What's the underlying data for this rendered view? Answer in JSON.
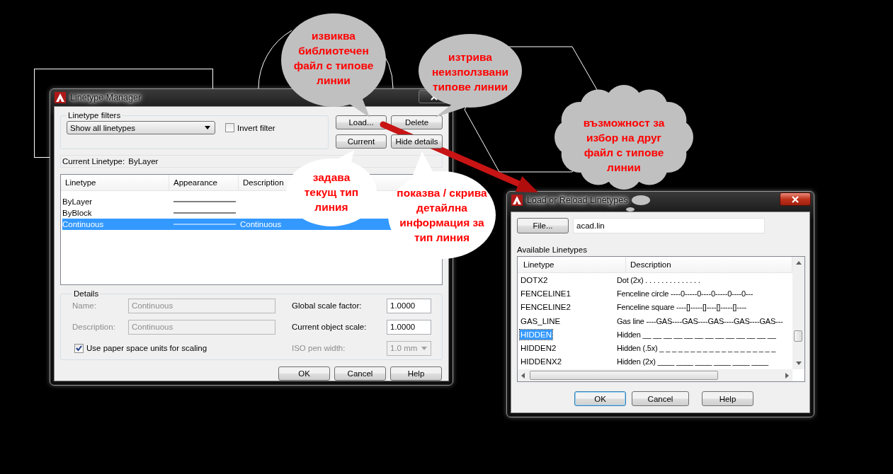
{
  "linetype_manager": {
    "title": "Linetype Manager",
    "filters": {
      "legend": "Linetype filters",
      "dropdown": "Show all linetypes",
      "invert_filter": {
        "label": "Invert filter",
        "checked": false
      }
    },
    "actions": [
      {
        "label": "Load..."
      },
      {
        "label": "Delete"
      },
      {
        "label": "Current"
      },
      {
        "label": "Hide details"
      }
    ],
    "current_linetype": {
      "label": "Current Linetype:",
      "value": "ByLayer"
    },
    "list": {
      "columns": [
        "Linetype",
        "Appearance",
        "Description"
      ],
      "rows": [
        {
          "linetype": "ByLayer",
          "selected": false
        },
        {
          "linetype": "ByBlock",
          "selected": false
        },
        {
          "linetype": "Continuous",
          "description": "Continuous",
          "selected": true
        }
      ]
    },
    "details": {
      "legend": "Details",
      "name": {
        "label": "Name:",
        "value": "Continuous",
        "disabled": true
      },
      "description": {
        "label": "Description:",
        "value": "Continuous",
        "disabled": true
      },
      "paper_space": {
        "label": "Use paper space units for scaling",
        "checked": true
      },
      "global_scale": {
        "label": "Global scale factor:",
        "value": "1.0000",
        "disabled": false
      },
      "object_scale": {
        "label": "Current object scale:",
        "value": "1.0000",
        "disabled": false
      },
      "iso_pen_width": {
        "label": "ISO pen width:",
        "value": "1.0 mm",
        "disabled": true
      }
    },
    "buttons": [
      {
        "label": "OK"
      },
      {
        "label": "Cancel"
      },
      {
        "label": "Help"
      }
    ]
  },
  "load_dialog": {
    "title": "Load or Reload Linetypes",
    "file_button": "File...",
    "file_field": "acad.lin",
    "list_label": "Available Linetypes",
    "columns": [
      "Linetype",
      "Description"
    ],
    "rows": [
      {
        "linetype": "DOTX2",
        "description": "Dot (2x) . . . . . . . . . . . . . .",
        "selected": false
      },
      {
        "linetype": "FENCELINE1",
        "description": "Fenceline circle ----0-----0----0-----0----0---",
        "selected": false
      },
      {
        "linetype": "FENCELINE2",
        "description": "Fenceline square ----[]-----[]----[]-----[]----",
        "selected": false
      },
      {
        "linetype": "GAS_LINE",
        "description": "Gas line ----GAS----GAS----GAS----GAS----GAS---",
        "selected": false
      },
      {
        "linetype": "HIDDEN",
        "description": "Hidden __ __ __ __ __ __ __ __ __ __ __ __ __",
        "selected": true
      },
      {
        "linetype": "HIDDEN2",
        "description": "Hidden (.5x) _ _ _ _ _ _ _ _ _ _ _ _ _ _ _ _ _ _ _",
        "selected": false
      },
      {
        "linetype": "HIDDENX2",
        "description": "Hidden (2x) ____ ____ ____ ____ ____ ____",
        "selected": false
      }
    ],
    "buttons": [
      {
        "label": "OK",
        "default": true
      },
      {
        "label": "Cancel",
        "default": false
      },
      {
        "label": "Help",
        "default": false
      }
    ]
  },
  "annotations": [
    {
      "kind": "speech",
      "color": "#c0c0c0",
      "lines": [
        "извиква",
        "библиотечен",
        "файл с типове",
        "линии"
      ]
    },
    {
      "kind": "speech",
      "color": "#c0c0c0",
      "lines": [
        "изтрива",
        "неизползвани",
        "типове линии"
      ]
    },
    {
      "kind": "cloud",
      "color": "#c0c0c0",
      "lines": [
        "възможност за",
        "избор на друг",
        "файл с типове",
        "линии"
      ]
    },
    {
      "kind": "speech",
      "color": "#ffffff",
      "lines": [
        "задава",
        "текущ тип",
        "линия"
      ]
    },
    {
      "kind": "speech",
      "color": "#ffffff",
      "lines": [
        "показва / скрива",
        "детайлна",
        "информация за",
        "тип линия"
      ]
    }
  ]
}
